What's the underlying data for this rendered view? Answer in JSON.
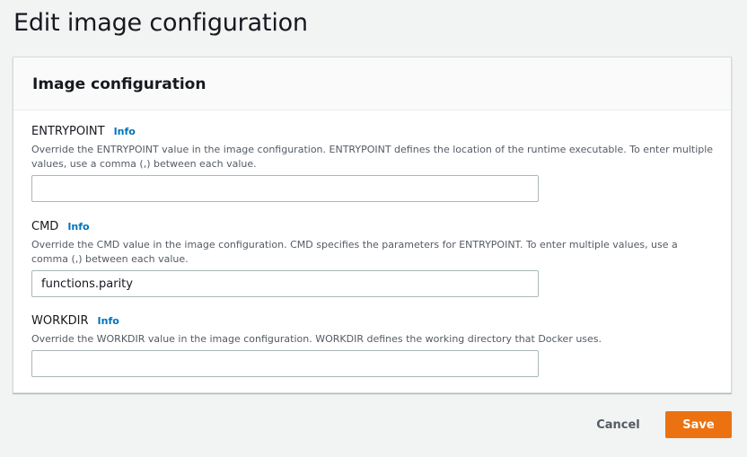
{
  "page": {
    "title": "Edit image configuration"
  },
  "panel": {
    "title": "Image configuration",
    "fields": [
      {
        "label": "ENTRYPOINT",
        "info": "Info",
        "description": "Override the ENTRYPOINT value in the image configuration. ENTRYPOINT defines the location of the runtime executable. To enter multiple values, use a comma (,) between each value.",
        "value": ""
      },
      {
        "label": "CMD",
        "info": "Info",
        "description": "Override the CMD value in the image configuration. CMD specifies the parameters for ENTRYPOINT. To enter multiple values, use a comma (,) between each value.",
        "value": "functions.parity"
      },
      {
        "label": "WORKDIR",
        "info": "Info",
        "description": "Override the WORKDIR value in the image configuration. WORKDIR defines the working directory that Docker uses.",
        "value": ""
      }
    ]
  },
  "actions": {
    "cancel_label": "Cancel",
    "save_label": "Save"
  },
  "colors": {
    "primary_button": "#ec7211",
    "link": "#0073bb"
  }
}
